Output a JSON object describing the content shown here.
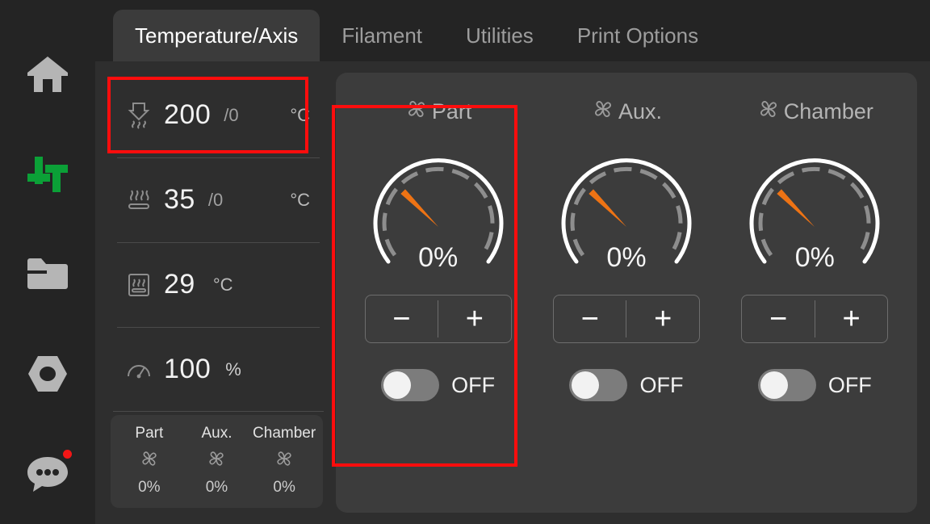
{
  "sidebar": {
    "items": [
      {
        "name": "home",
        "icon": "home-icon",
        "active": false
      },
      {
        "name": "controls",
        "icon": "sliders-icon",
        "active": true
      },
      {
        "name": "files",
        "icon": "folder-icon",
        "active": false
      },
      {
        "name": "settings",
        "icon": "nut-icon",
        "active": false
      },
      {
        "name": "messages",
        "icon": "chat-icon",
        "active": false,
        "badge": true
      }
    ],
    "active_color": "#0ba037",
    "icon_color": "#b5b5b5",
    "badge_color": "#f21616"
  },
  "tabs": [
    {
      "label": "Temperature/Axis",
      "active": true
    },
    {
      "label": "Filament",
      "active": false
    },
    {
      "label": "Utilities",
      "active": false
    },
    {
      "label": "Print Options",
      "active": false
    }
  ],
  "status": {
    "rows": [
      {
        "icon": "nozzle-icon",
        "value": "200",
        "target": "/0",
        "unit": "°C",
        "unit_inline": false
      },
      {
        "icon": "bed-icon",
        "value": "35",
        "target": "/0",
        "unit": "°C",
        "unit_inline": false
      },
      {
        "icon": "chamber-icon",
        "value": "29",
        "target": "",
        "unit": "°C",
        "unit_inline": true
      },
      {
        "icon": "speed-icon",
        "value": "100",
        "target": "",
        "unit": "%",
        "unit_inline": true
      }
    ],
    "fan_summary": [
      {
        "name": "Part",
        "icon": "fan-icon",
        "percent": "0%"
      },
      {
        "name": "Aux.",
        "icon": "fan-icon",
        "percent": "0%"
      },
      {
        "name": "Chamber",
        "icon": "fan-icon",
        "percent": "0%"
      }
    ]
  },
  "fans": [
    {
      "name": "Part",
      "icon": "fan-icon",
      "gauge_value": "0%",
      "gauge_percent": 0,
      "decrease_label": "−",
      "increase_label": "+",
      "toggle_state": "OFF",
      "toggle_on": false
    },
    {
      "name": "Aux.",
      "icon": "fan-icon",
      "gauge_value": "0%",
      "gauge_percent": 0,
      "decrease_label": "−",
      "increase_label": "+",
      "toggle_state": "OFF",
      "toggle_on": false
    },
    {
      "name": "Chamber",
      "icon": "fan-icon",
      "gauge_value": "0%",
      "gauge_percent": 0,
      "decrease_label": "−",
      "increase_label": "+",
      "toggle_state": "OFF",
      "toggle_on": false
    }
  ],
  "highlights": [
    {
      "name": "nozzle-temperature-highlight",
      "color": "#fd0d0d"
    },
    {
      "name": "part-fan-highlight",
      "color": "#fd0d0d"
    }
  ],
  "theme": {
    "bg": "#2e2e2e",
    "sidebar_bg": "#242424",
    "panel_bg": "#3c3c3c",
    "needle": "#ee7314",
    "gauge_arc": "#ffffff",
    "gauge_ticks": "#8e8e8e"
  }
}
